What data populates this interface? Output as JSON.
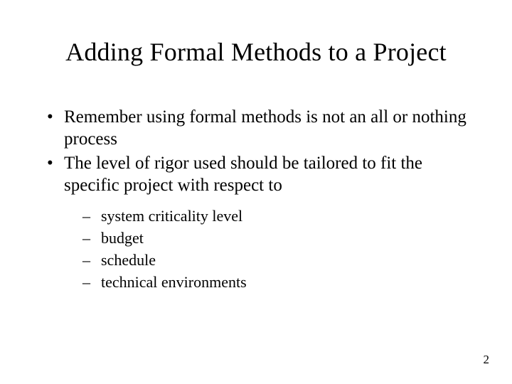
{
  "title": "Adding Formal Methods to a Project",
  "bullets": [
    {
      "text": "Remember using formal methods is not an all or nothing process"
    },
    {
      "text": "The level of rigor used should be tailored to fit the specific project with respect to",
      "sub": [
        "system criticality level",
        "budget",
        "schedule",
        "technical environments"
      ]
    }
  ],
  "page_number": "2"
}
